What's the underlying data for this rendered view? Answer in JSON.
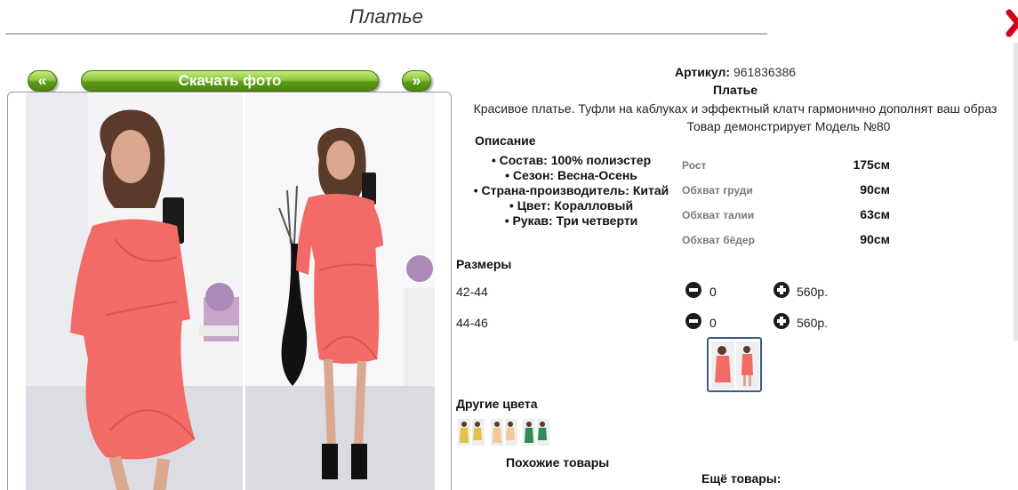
{
  "page": {
    "title": "Платье"
  },
  "colors": {
    "accent_green": "#7fbf2a",
    "close_red": "#d0021b",
    "dress_coral": "#f26b66"
  },
  "icons": {
    "close": "close-x-icon",
    "minus": "minus-circle-icon",
    "plus": "plus-circle-icon"
  },
  "gallery": {
    "prev_label": "«",
    "download_label": "Скачать фото",
    "next_label": "»"
  },
  "product": {
    "article_label": "Артикул:",
    "article_value": "961836386",
    "name": "Платье",
    "description": "Красивое платье. Туфли на каблуках и эффектный клатч гармонично дополнят ваш образ",
    "model_note": "Товар демонстрирует Модель №80"
  },
  "details": {
    "heading": "Описание",
    "items": [
      "Состав: 100% полиэстер",
      "Сезон: Весна-Осень",
      "Страна-производитель: Китай",
      "Цвет: Коралловый",
      "Рукав: Три четверти"
    ]
  },
  "measurements": [
    {
      "label": "Рост",
      "value": "175см"
    },
    {
      "label": "Обхват груди",
      "value": "90см"
    },
    {
      "label": "Обхват талии",
      "value": "63см"
    },
    {
      "label": "Обхват бёдер",
      "value": "90см"
    }
  ],
  "sizes": {
    "heading": "Размеры",
    "rows": [
      {
        "size": "42-44",
        "qty": "0",
        "price": "560р."
      },
      {
        "size": "44-46",
        "qty": "0",
        "price": "560р."
      }
    ]
  },
  "other_colors": {
    "heading": "Другие цвета",
    "swatches": [
      {
        "color": "#e0c14a"
      },
      {
        "color": "#f0c89a"
      },
      {
        "color": "#2f8a55"
      }
    ]
  },
  "footer": {
    "similar_label": "Похожие товары",
    "more_label": "Ещё товары:"
  }
}
